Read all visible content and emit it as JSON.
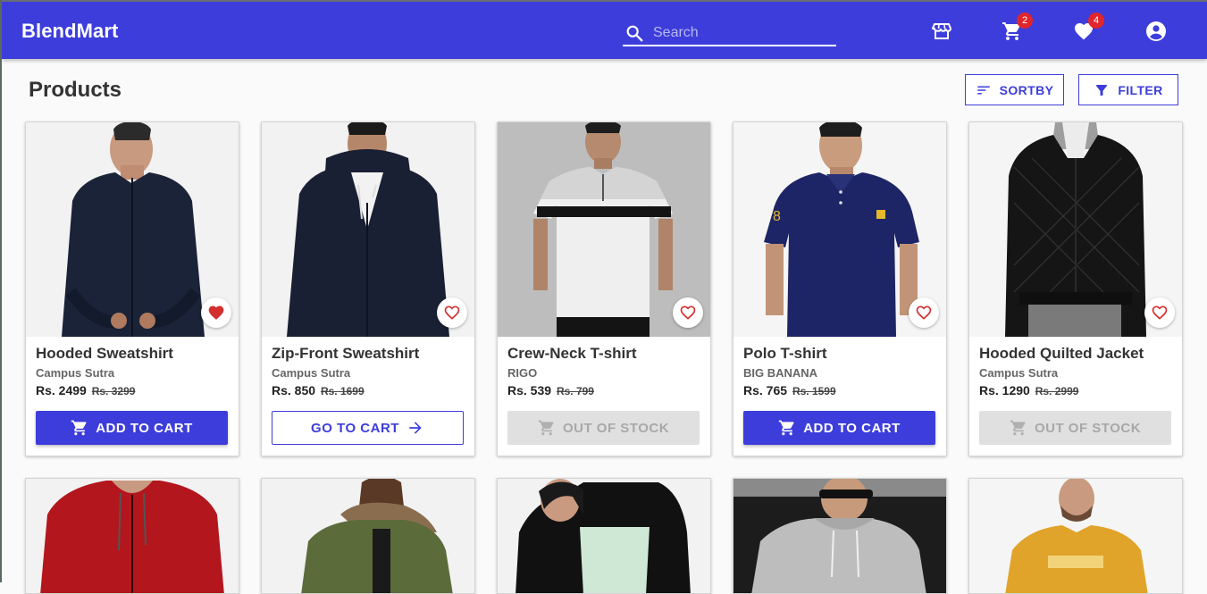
{
  "app": {
    "brand": "BlendMart"
  },
  "search": {
    "placeholder": "Search"
  },
  "header": {
    "icons": [
      {
        "name": "store-icon"
      },
      {
        "name": "cart-icon",
        "badge": "2"
      },
      {
        "name": "wishlist-icon",
        "badge": "4"
      },
      {
        "name": "account-icon"
      }
    ]
  },
  "main": {
    "title": "Products",
    "sort_label": "SORTBY",
    "filter_label": "FILTER"
  },
  "products": [
    {
      "name": "Hooded Sweatshirt",
      "brand": "Campus Sutra",
      "price": "Rs. 2499",
      "old_price": "Rs. 3299",
      "button": "ADD TO CART",
      "state": "add",
      "wishlisted": true
    },
    {
      "name": "Zip-Front Sweatshirt",
      "brand": "Campus Sutra",
      "price": "Rs. 850",
      "old_price": "Rs. 1699",
      "button": "GO TO CART",
      "state": "goto",
      "wishlisted": false
    },
    {
      "name": "Crew-Neck T-shirt",
      "brand": "RIGO",
      "price": "Rs. 539",
      "old_price": "Rs. 799",
      "button": "OUT OF STOCK",
      "state": "oos",
      "wishlisted": false
    },
    {
      "name": "Polo T-shirt",
      "brand": "BIG BANANA",
      "price": "Rs. 765",
      "old_price": "Rs. 1599",
      "button": "ADD TO CART",
      "state": "add",
      "wishlisted": false
    },
    {
      "name": "Hooded Quilted Jacket",
      "brand": "Campus Sutra",
      "price": "Rs. 1290",
      "old_price": "Rs. 2999",
      "button": "OUT OF STOCK",
      "state": "oos",
      "wishlisted": false
    }
  ],
  "colors": {
    "primary": "#3d3ddb",
    "badge": "#e0262d",
    "wishlist_heart": "#d32f2f",
    "disabled_bg": "#e0e0e0"
  }
}
